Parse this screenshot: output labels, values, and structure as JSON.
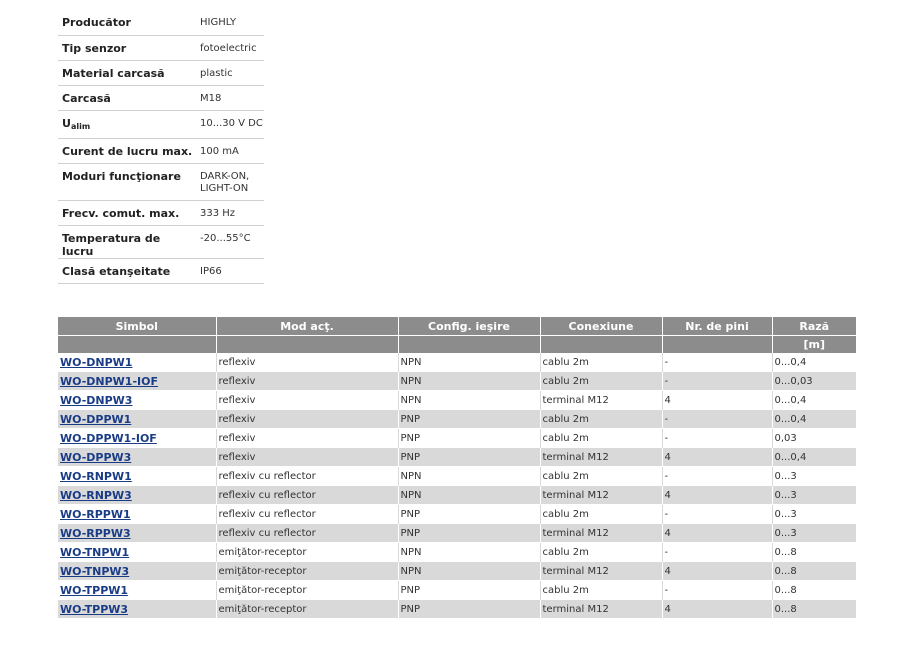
{
  "specs": [
    {
      "label": "Producător",
      "value": "HIGHLY"
    },
    {
      "label": "Tip senzor",
      "value": "fotoelectric"
    },
    {
      "label": "Material carcasă",
      "value": "plastic"
    },
    {
      "label": "Carcasă",
      "value": "M18"
    },
    {
      "label": "U",
      "label_sub": "alim",
      "value": "10...30 V DC"
    },
    {
      "label": "Curent de lucru max.",
      "value": "100 mA"
    },
    {
      "label": "Moduri funcţionare",
      "value": "DARK-ON, LIGHT-ON"
    },
    {
      "label": "Frecv. comut. max.",
      "value": "333 Hz"
    },
    {
      "label": "Temperatura de lucru",
      "value": "-20...55°C"
    },
    {
      "label": "Clasă etanşeitate",
      "value": "IP66"
    }
  ],
  "table": {
    "headers": [
      "Simbol",
      "Mod acţ.",
      "Config. ieşire",
      "Conexiune",
      "Nr. de pini",
      "Rază"
    ],
    "units": [
      "",
      "",
      "",
      "",
      "",
      "[m]"
    ],
    "rows": [
      [
        "WO-DNPW1",
        "reflexiv",
        "NPN",
        "cablu 2m",
        "-",
        "0...0,4"
      ],
      [
        "WO-DNPW1-IOF",
        "reflexiv",
        "NPN",
        "cablu 2m",
        "-",
        "0...0,03"
      ],
      [
        "WO-DNPW3",
        "reflexiv",
        "NPN",
        "terminal M12",
        "4",
        "0...0,4"
      ],
      [
        "WO-DPPW1",
        "reflexiv",
        "PNP",
        "cablu 2m",
        "-",
        "0...0,4"
      ],
      [
        "WO-DPPW1-IOF",
        "reflexiv",
        "PNP",
        "cablu 2m",
        "-",
        "0,03"
      ],
      [
        "WO-DPPW3",
        "reflexiv",
        "PNP",
        "terminal M12",
        "4",
        "0...0,4"
      ],
      [
        "WO-RNPW1",
        "reflexiv cu reflector",
        "NPN",
        "cablu 2m",
        "-",
        "0...3"
      ],
      [
        "WO-RNPW3",
        "reflexiv cu reflector",
        "NPN",
        "terminal M12",
        "4",
        "0...3"
      ],
      [
        "WO-RPPW1",
        "reflexiv cu reflector",
        "PNP",
        "cablu 2m",
        "-",
        "0...3"
      ],
      [
        "WO-RPPW3",
        "reflexiv cu reflector",
        "PNP",
        "terminal M12",
        "4",
        "0...3"
      ],
      [
        "WO-TNPW1",
        "emiţător-receptor",
        "NPN",
        "cablu 2m",
        "-",
        "0...8"
      ],
      [
        "WO-TNPW3",
        "emiţător-receptor",
        "NPN",
        "terminal M12",
        "4",
        "0...8"
      ],
      [
        "WO-TPPW1",
        "emiţător-receptor",
        "PNP",
        "cablu 2m",
        "-",
        "0...8"
      ],
      [
        "WO-TPPW3",
        "emiţător-receptor",
        "PNP",
        "terminal M12",
        "4",
        "0...8"
      ]
    ]
  }
}
